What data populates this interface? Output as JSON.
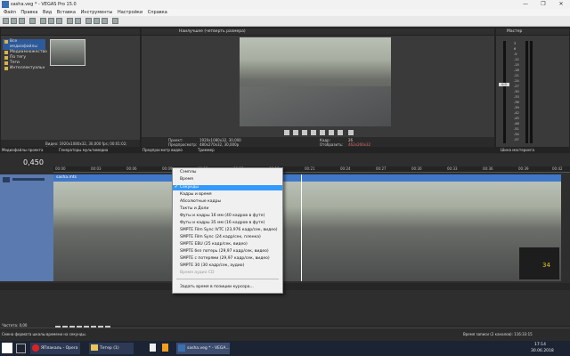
{
  "window": {
    "title": "sasha.veg * - VEGAS Pro 15.0",
    "minimize": "—",
    "maximize": "❐",
    "close": "✕"
  },
  "menu": [
    "Файл",
    "Правка",
    "Вид",
    "Вставка",
    "Инструменты",
    "Настройки",
    "Справка"
  ],
  "explorer": {
    "tree": [
      "Все медиафайлы",
      "Медиамножество",
      "По тегу",
      "Теги",
      "Интеллектуальн"
    ],
    "status": "Видео: 1920x1080x32, 30,000 fps; 00:01:02; Альфа-кана"
  },
  "preview": {
    "quality": "Наилучшее (четверть размера)",
    "project": "Проект:",
    "project_value": "1920x1080x32, 30,000",
    "preview": "Предпросмотр:",
    "preview_value": "480x270x32, 30,000p",
    "frame": "Кадр:",
    "frame_value": "26",
    "display": "Отобразить:",
    "display_value": "462x260x32"
  },
  "tabs": {
    "left": [
      "Медиафайлы проекта",
      "Генераторы мультимедиа"
    ],
    "center": [
      "Предпросмотр видео",
      "Триммер"
    ],
    "right": "Шина мастеринга"
  },
  "mixer": {
    "label": "Мастер",
    "scale": [
      "3",
      "6",
      "-9",
      "-12",
      "-15",
      "-18",
      "-21",
      "-24",
      "-27",
      "-30",
      "-33",
      "-36",
      "-39",
      "-42",
      "-45",
      "-48",
      "-51",
      "-54",
      "-57"
    ],
    "value": "0.0"
  },
  "timeline": {
    "position": "0,450",
    "ruler": [
      "00:00",
      "00:03",
      "00:06",
      "00:09",
      "00:12",
      "00:15",
      "00:18",
      "00:21",
      "00:24",
      "00:27",
      "00:30",
      "00:33",
      "00:36",
      "00:39",
      "00:42"
    ],
    "clip_name": "sasha.mts",
    "rate": "Частота: 0,00",
    "zoom_value": "34",
    "end_time": "6,450"
  },
  "context_menu": {
    "items": [
      {
        "label": "Сэмплы",
        "state": "normal"
      },
      {
        "label": "Время",
        "state": "normal"
      },
      {
        "label": "Секунды",
        "state": "selected",
        "checked": true
      },
      {
        "label": "Кадры и время",
        "state": "normal"
      },
      {
        "label": "Абсолютные кадры",
        "state": "normal"
      },
      {
        "label": "Такты и Доли",
        "state": "normal"
      },
      {
        "label": "Футы и кадры 16 мм (40 кадров в футе)",
        "state": "normal"
      },
      {
        "label": "Футы и кадры 35 мм (16 кадров в футе)",
        "state": "normal"
      },
      {
        "label": "SMPTE Film Sync IVTC (23,976 кадр/сек, видео)",
        "state": "normal"
      },
      {
        "label": "SMPTE Film Sync (24 кадр/сек, пленка)",
        "state": "normal"
      },
      {
        "label": "SMPTE EBU (25 кадр/сек, видео)",
        "state": "normal"
      },
      {
        "label": "SMPTE без потерь (29,97 кадр/сек, видео)",
        "state": "normal"
      },
      {
        "label": "SMPTE с потерями (29,97 кадр/сек, видео)",
        "state": "normal"
      },
      {
        "label": "SMPTE 30 (30 кадр/сек, аудио)",
        "state": "normal"
      },
      {
        "label": "Время аудио CD",
        "state": "disabled"
      },
      {
        "label": "Задать время в позиции курсора...",
        "state": "normal"
      }
    ]
  },
  "statusbar": {
    "left": "Смена формата шкалы времени на секунды.",
    "right": "Время записи (2 каналов): 116:33:15"
  },
  "taskbar": {
    "opera": "ЯПлакаль - Opera",
    "explorer": "Тетер (1)",
    "vegas": "sasha.veg * - VEGA...",
    "time": "17:14",
    "date": "30.06.2018"
  },
  "colors": {
    "accent": "#3399ff",
    "clip_header": "#3f78c8",
    "track_header": "#5b7ab0",
    "meter_green": "#a6c62b"
  }
}
